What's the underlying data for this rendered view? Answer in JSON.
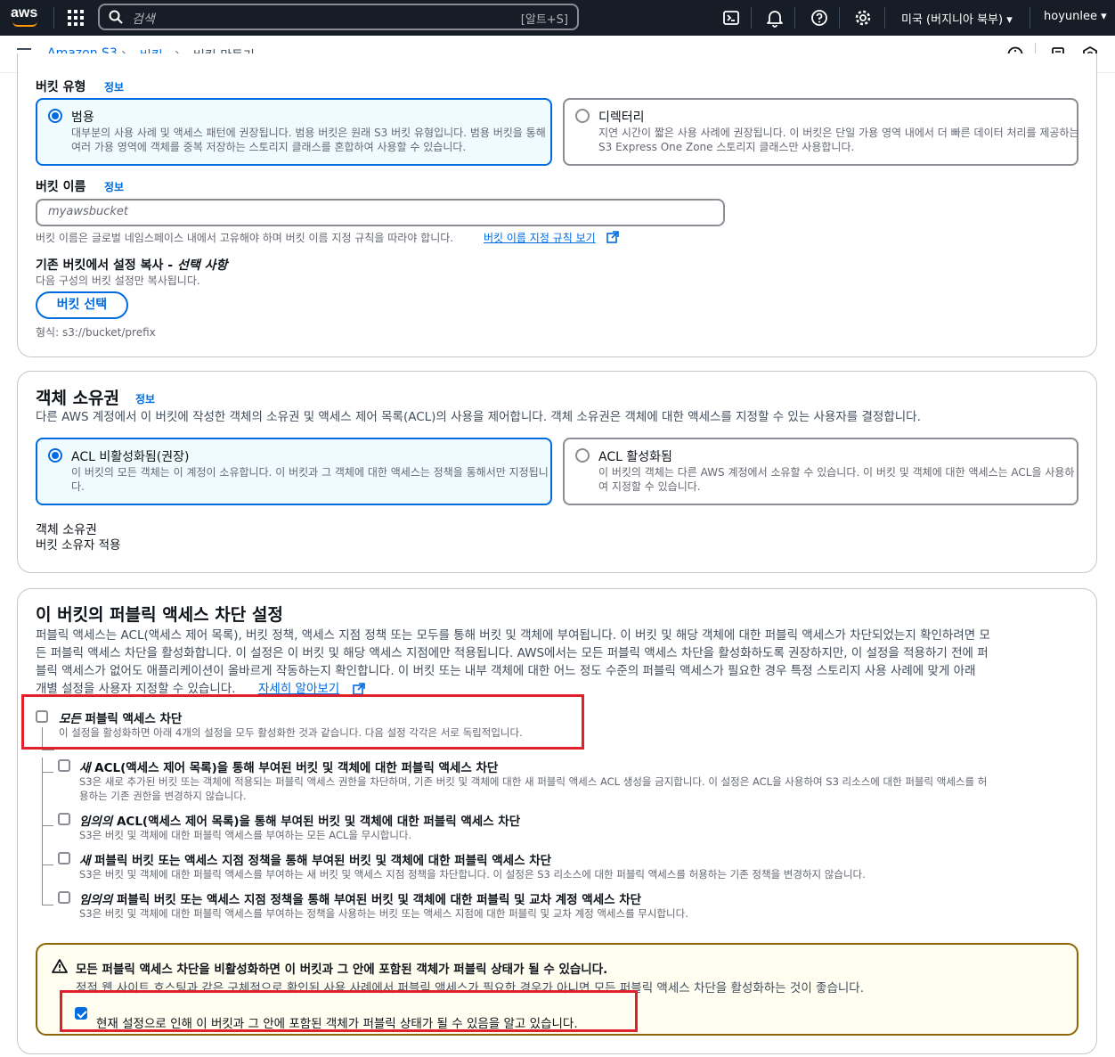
{
  "topnav": {
    "logo": "aws",
    "search_placeholder": "검색",
    "search_shortcut": "[알트+S]",
    "region": "미국 (버지니아 북부) ▾",
    "user": "hoyunlee ▾",
    "icons": [
      "grid-icon",
      "search-icon",
      "cloudshell-icon",
      "bell-icon",
      "help-icon",
      "settings-icon"
    ]
  },
  "breadcrumb": {
    "items": [
      "Amazon S3",
      "버킷",
      "버킷 만들기"
    ],
    "separator": "›"
  },
  "general": {
    "bucket_type_label": "버킷 유형",
    "info": "정보",
    "type_general_title": "범용",
    "type_general_desc": "대부분의 사용 사례 및 액세스 패턴에 권장됩니다. 범용 버킷은 원래 S3 버킷 유형입니다. 범용 버킷을 통해 여러 가용 영역에 객체를 중복 저장하는 스토리지 클래스를 혼합하여 사용할 수 있습니다.",
    "type_directory_title": "디렉터리",
    "type_directory_desc": "지연 시간이 짧은 사용 사례에 권장됩니다. 이 버킷은 단일 가용 영역 내에서 더 빠른 데이터 처리를 제공하는 S3 Express One Zone 스토리지 클래스만 사용합니다.",
    "bucket_name_label": "버킷 이름",
    "bucket_name_placeholder": "myawsbucket",
    "bucket_name_help": "버킷 이름은 글로벌 네임스페이스 내에서 고유해야 하며 버킷 이름 지정 규칙을 따라야 합니다.",
    "bucket_name_rules_link": "버킷 이름 지정 규칙 보기",
    "copy_label": "기존 버킷에서 설정 복사 - ",
    "copy_label_optional": "선택 사항",
    "copy_desc": "다음 구성의 버킷 설정만 복사됩니다.",
    "choose_bucket_button": "버킷 선택",
    "format_hint": "형식: s3://bucket/prefix"
  },
  "ownership": {
    "title": "객체 소유권",
    "info": "정보",
    "desc": "다른 AWS 계정에서 이 버킷에 작성한 객체의 소유권 및 액세스 제어 목록(ACL)의 사용을 제어합니다. 객체 소유권은 객체에 대한 액세스를 지정할 수 있는 사용자를 결정합니다.",
    "acl_disabled_title": "ACL 비활성화됨(권장)",
    "acl_disabled_desc": "이 버킷의 모든 객체는 이 계정이 소유합니다. 이 버킷과 그 객체에 대한 액세스는 정책을 통해서만 지정됩니다.",
    "acl_enabled_title": "ACL 활성화됨",
    "acl_enabled_desc": "이 버킷의 객체는 다른 AWS 계정에서 소유할 수 있습니다. 이 버킷 및 객체에 대한 액세스는 ACL을 사용하여 지정할 수 있습니다.",
    "ownership_label": "객체 소유권",
    "ownership_value": "버킷 소유자 적용"
  },
  "public_access": {
    "title": "이 버킷의 퍼블릭 액세스 차단 설정",
    "desc_line1": "퍼블릭 액세스는 ACL(액세스 제어 목록), 버킷 정책, 액세스 지점 정책 또는 모두를 통해 버킷 및 객체에 부여됩니다. 이 버킷 및 해당 객체에 대한 퍼블릭 액세스가 차단되었는지 확인하려면 모",
    "desc_line2": "든 퍼블릭 액세스 차단을 활성화합니다. 이 설정은 이 버킷 및 해당 액세스 지점에만 적용됩니다. AWS에서는 모든 퍼블릭 액세스 차단을 활성화하도록 권장하지만, 이 설정을 적용하기 전에 퍼",
    "desc_line3": "블릭 액세스가 없어도 애플리케이션이 올바르게 작동하는지 확인합니다. 이 버킷 또는 내부 객체에 대한 어느 정도 수준의 퍼블릭 액세스가 필요한 경우 특정 스토리지 사용 사례에 맞게 아래",
    "desc_line4": "개별 설정을 사용자 지정할 수 있습니다.",
    "learn_more_link": "자세히 알아보기",
    "block_all_em": "모든",
    "block_all_rest": " 퍼블릭 액세스 차단",
    "block_all_desc": "이 설정을 활성화하면 아래 4개의 설정을 모두 활성화한 것과 같습니다. 다음 설정 각각은 서로 독립적입니다.",
    "options": [
      {
        "em": "새",
        "title": " ACL(액세스 제어 목록)을 통해 부여된 버킷 및 객체에 대한 퍼블릭 액세스 차단",
        "desc1": "S3은 새로 추가된 버킷 또는 객체에 적용되는 퍼블릭 액세스 권한을 차단하며, 기존 버킷 및 객체에 대한 새 퍼블릭 액세스 ACL 생성을 금지합니다. 이 설정은 ACL을 사용하여 S3 리소스에 대한 퍼블릭 액세스를 허",
        "desc2": "용하는 기존 권한을 변경하지 않습니다.",
        "checked": false
      },
      {
        "em": "임의의",
        "title": " ACL(액세스 제어 목록)을 통해 부여된 버킷 및 객체에 대한 퍼블릭 액세스 차단",
        "desc1": "S3은 버킷 및 객체에 대한 퍼블릭 액세스를 부여하는 모든 ACL을 무시합니다.",
        "desc2": "",
        "checked": false
      },
      {
        "em": "새",
        "title": " 퍼블릭 버킷 또는 액세스 지점 정책을 통해 부여된 버킷 및 객체에 대한 퍼블릭 액세스 차단",
        "desc1": "S3은 버킷 및 객체에 대한 퍼블릭 액세스를 부여하는 새 버킷 및 액세스 지점 정책을 차단합니다. 이 설정은 S3 리소스에 대한 퍼블릭 액세스를 허용하는 기존 정책을 변경하지 않습니다.",
        "desc2": "",
        "checked": false
      },
      {
        "em": "임의의",
        "title": " 퍼블릭 버킷 또는 액세스 지점 정책을 통해 부여된 버킷 및 객체에 대한 퍼블릭 및 교차 계정 액세스 차단",
        "desc1": "S3은 버킷 및 객체에 대한 퍼블릭 액세스를 부여하는 정책을 사용하는 버킷 또는 액세스 지점에 대한 퍼블릭 및 교차 계정 액세스를 무시합니다.",
        "desc2": "",
        "checked": false
      }
    ],
    "warning_title": "모든 퍼블릭 액세스 차단을 비활성화하면 이 버킷과 그 안에 포함된 객체가 퍼블릭 상태가 될 수 있습니다.",
    "warning_desc": "정적 웹 사이트 호스팅과 같은 구체적으로 확인된 사용 사례에서 퍼블릭 액세스가 필요한 경우가 아니면 모든 퍼블릭 액세스 차단을 활성화하는 것이 좋습니다.",
    "acknowledge": "현재 설정으로 인해 이 버킷과 그 안에 포함된 객체가 퍼블릭 상태가 될 수 있음을 알고 있습니다.",
    "acknowledge_checked": true
  },
  "colors": {
    "nav_bg": "#161d26",
    "link": "#006ce0",
    "highlight_red": "#e0202a",
    "warning_border": "#8d6605"
  }
}
